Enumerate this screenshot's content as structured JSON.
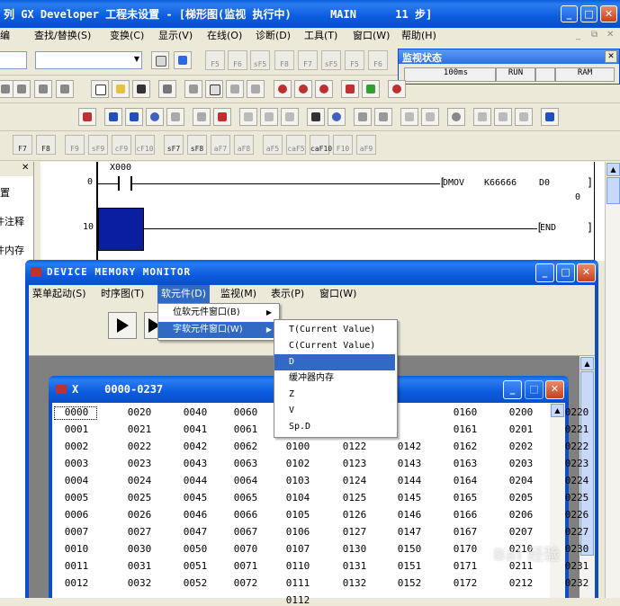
{
  "main_window": {
    "title": "列 GX Developer 工程未设置 - [梯形图(监视 执行中)      MAIN      11 步]"
  },
  "menubar": {
    "items": [
      {
        "label": "编"
      },
      {
        "label": "查找/替换(S)"
      },
      {
        "label": "变换(C)"
      },
      {
        "label": "显示(V)"
      },
      {
        "label": "在线(O)"
      },
      {
        "label": "诊断(D)"
      },
      {
        "label": "工具(T)"
      },
      {
        "label": "窗口(W)"
      },
      {
        "label": "帮助(H)"
      }
    ]
  },
  "fkeys_row1": [
    "F5",
    "F6",
    "sF5",
    "F8",
    "F7",
    "sF5",
    "F5",
    "F6"
  ],
  "fkeys_row4": [
    "F9",
    "sF9",
    "cF9",
    "cF10",
    "sF7",
    "sF8",
    "aF7",
    "aF8",
    "aF5",
    "caF5",
    "caF10",
    "F10",
    "aF9"
  ],
  "fkeys_row4_left": [
    "F7",
    "F8"
  ],
  "monitor_status": {
    "title": "监视状态",
    "scan_time": "100ms",
    "cpu_status": "RUN",
    "memory": "RAM"
  },
  "ladder": {
    "rung1_step": "0",
    "rung1_contact": "X000",
    "rung1_instruction": "DMOV",
    "rung1_source": "K66666",
    "rung1_dest": "D0",
    "rung1_value": "0",
    "rung2_step": "10",
    "rung2_instruction": "END"
  },
  "left_panel": {
    "items": [
      "置",
      "件注释",
      "件内存"
    ]
  },
  "device_monitor": {
    "title": "DEVICE MEMORY MONITOR",
    "menu": [
      {
        "label": "菜单起动(S)"
      },
      {
        "label": "时序图(T)"
      },
      {
        "label": "软元件(D)"
      },
      {
        "label": "监视(M)"
      },
      {
        "label": "表示(P)"
      },
      {
        "label": "窗口(W)"
      }
    ],
    "submenu": [
      {
        "label": "位软元件窗口(B)"
      },
      {
        "label": "字软元件窗口(W)"
      }
    ],
    "dropdown": [
      {
        "label": "T(Current Value)"
      },
      {
        "label": "C(Current Value)"
      },
      {
        "label": "D"
      },
      {
        "label": "缓冲器内存"
      },
      {
        "label": "Z"
      },
      {
        "label": "V"
      },
      {
        "label": "Sp.D"
      }
    ]
  },
  "x_window": {
    "title": "X    0000-0237",
    "columns": [
      [
        "0000",
        "0001",
        "0002",
        "0003",
        "0004",
        "0005",
        "0006",
        "0007",
        "0010",
        "0011",
        "0012"
      ],
      [
        "0020",
        "0021",
        "0022",
        "0023",
        "0024",
        "0025",
        "0026",
        "0027",
        "0030",
        "0031",
        "0032"
      ],
      [
        "0040",
        "0041",
        "0042",
        "0043",
        "0044",
        "0045",
        "0046",
        "0047",
        "0050",
        "0051",
        "0052"
      ],
      [
        "0060",
        "0061",
        "0062",
        "0063",
        "0064",
        "0065",
        "0066",
        "0067",
        "0070",
        "0071",
        "0072"
      ],
      [
        "0100",
        "0102",
        "0103",
        "0104",
        "0105",
        "0106",
        "0107",
        "0110",
        "0111",
        "0112"
      ],
      [
        "0122",
        "0123",
        "0124",
        "0125",
        "0126",
        "0127",
        "0130",
        "0131",
        "0132"
      ],
      [
        "0142",
        "0143",
        "0144",
        "0145",
        "0146",
        "0147",
        "0150",
        "0151",
        "0152"
      ],
      [
        "0160",
        "0161",
        "0162",
        "0163",
        "0164",
        "0165",
        "0166",
        "0167",
        "0170",
        "0171",
        "0172"
      ],
      [
        "0200",
        "0201",
        "0202",
        "0203",
        "0204",
        "0205",
        "0206",
        "0207",
        "0210",
        "0211",
        "0212"
      ],
      [
        "0220",
        "0221",
        "0222",
        "0223",
        "0224",
        "0225",
        "0226",
        "0227",
        "0230",
        "0231",
        "0232"
      ]
    ]
  },
  "watermark": {
    "text": "Bai 经验"
  }
}
